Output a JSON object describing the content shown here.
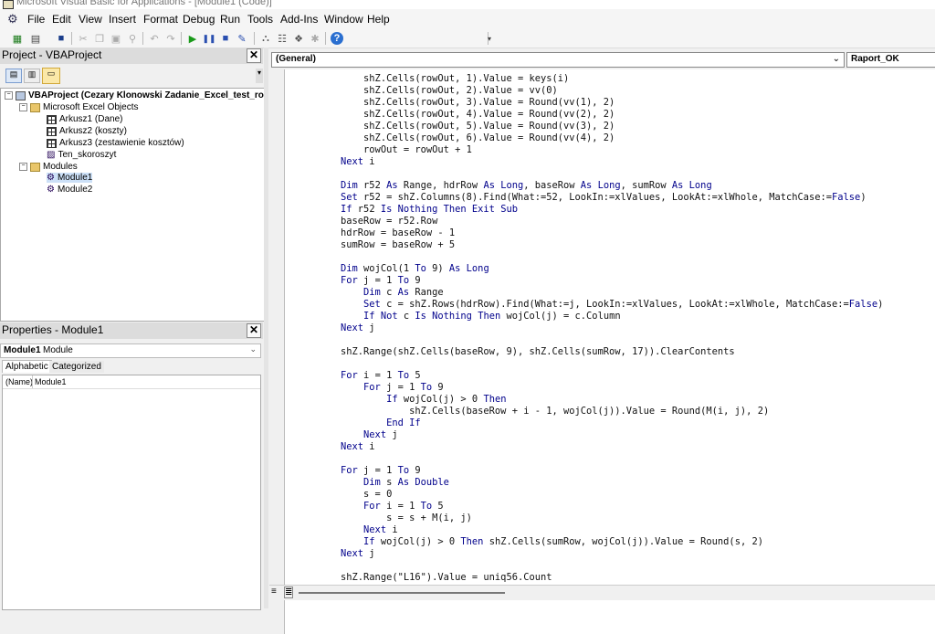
{
  "window": {
    "title": "Microsoft Visual Basic for Applications - [Module1 (Code)]"
  },
  "menu": [
    "File",
    "Edit",
    "View",
    "Insert",
    "Format",
    "Debug",
    "Run",
    "Tools",
    "Add-Ins",
    "Window",
    "Help"
  ],
  "project_panel": {
    "title": "Project - VBAProject",
    "root": "VBAProject (Cezary Klonowski Zadanie_Excel_test_roz",
    "excel_objects_folder": "Microsoft Excel Objects",
    "sheets": [
      "Arkusz1 (Dane)",
      "Arkusz2 (koszty)",
      "Arkusz3 (zestawienie kosztów)",
      "Ten_skoroszyt"
    ],
    "modules_folder": "Modules",
    "modules": [
      "Module1",
      "Module2"
    ]
  },
  "properties_panel": {
    "title": "Properties - Module1",
    "object_name": "Module1",
    "object_type": "Module",
    "tabs": [
      "Alphabetic",
      "Categorized"
    ],
    "row_key": "(Name)",
    "row_value": "Module1"
  },
  "code_window": {
    "object_combo": "(General)",
    "proc_combo": "Raport_OK",
    "lines": [
      [
        [
          "t",
          "        shZ.Cells(rowOut, 1).Value = keys(i)"
        ]
      ],
      [
        [
          "t",
          "        shZ.Cells(rowOut, 2).Value = vv(0)"
        ]
      ],
      [
        [
          "t",
          "        shZ.Cells(rowOut, 3).Value = Round(vv(1), 2)"
        ]
      ],
      [
        [
          "t",
          "        shZ.Cells(rowOut, 4).Value = Round(vv(2), 2)"
        ]
      ],
      [
        [
          "t",
          "        shZ.Cells(rowOut, 5).Value = Round(vv(3), 2)"
        ]
      ],
      [
        [
          "t",
          "        shZ.Cells(rowOut, 6).Value = Round(vv(4), 2)"
        ]
      ],
      [
        [
          "t",
          "        rowOut = rowOut + 1"
        ]
      ],
      [
        [
          "k",
          "    Next"
        ],
        [
          "t",
          " i"
        ]
      ],
      [
        [
          "t",
          ""
        ]
      ],
      [
        [
          "k",
          "    Dim"
        ],
        [
          "t",
          " r52 "
        ],
        [
          "k",
          "As"
        ],
        [
          "t",
          " Range, hdrRow "
        ],
        [
          "k",
          "As Long"
        ],
        [
          "t",
          ", baseRow "
        ],
        [
          "k",
          "As Long"
        ],
        [
          "t",
          ", sumRow "
        ],
        [
          "k",
          "As Long"
        ]
      ],
      [
        [
          "k",
          "    Set"
        ],
        [
          "t",
          " r52 = shZ.Columns(8).Find(What:=52, LookIn:=xlValues, LookAt:=xlWhole, MatchCase:="
        ],
        [
          "k",
          "False"
        ],
        [
          "t",
          ")"
        ]
      ],
      [
        [
          "k",
          "    If"
        ],
        [
          "t",
          " r52 "
        ],
        [
          "k",
          "Is Nothing Then Exit Sub"
        ]
      ],
      [
        [
          "t",
          "    baseRow = r52.Row"
        ]
      ],
      [
        [
          "t",
          "    hdrRow = baseRow - 1"
        ]
      ],
      [
        [
          "t",
          "    sumRow = baseRow + 5"
        ]
      ],
      [
        [
          "t",
          ""
        ]
      ],
      [
        [
          "k",
          "    Dim"
        ],
        [
          "t",
          " wojCol(1 "
        ],
        [
          "k",
          "To"
        ],
        [
          "t",
          " 9) "
        ],
        [
          "k",
          "As Long"
        ]
      ],
      [
        [
          "k",
          "    For"
        ],
        [
          "t",
          " j = 1 "
        ],
        [
          "k",
          "To"
        ],
        [
          "t",
          " 9"
        ]
      ],
      [
        [
          "k",
          "        Dim"
        ],
        [
          "t",
          " c "
        ],
        [
          "k",
          "As"
        ],
        [
          "t",
          " Range"
        ]
      ],
      [
        [
          "k",
          "        Set"
        ],
        [
          "t",
          " c = shZ.Rows(hdrRow).Find(What:=j, LookIn:=xlValues, LookAt:=xlWhole, MatchCase:="
        ],
        [
          "k",
          "False"
        ],
        [
          "t",
          ")"
        ]
      ],
      [
        [
          "k",
          "        If Not"
        ],
        [
          "t",
          " c "
        ],
        [
          "k",
          "Is Nothing Then"
        ],
        [
          "t",
          " wojCol(j) = c.Column"
        ]
      ],
      [
        [
          "k",
          "    Next"
        ],
        [
          "t",
          " j"
        ]
      ],
      [
        [
          "t",
          ""
        ]
      ],
      [
        [
          "t",
          "    shZ.Range(shZ.Cells(baseRow, 9), shZ.Cells(sumRow, 17)).ClearContents"
        ]
      ],
      [
        [
          "t",
          ""
        ]
      ],
      [
        [
          "k",
          "    For"
        ],
        [
          "t",
          " i = 1 "
        ],
        [
          "k",
          "To"
        ],
        [
          "t",
          " 5"
        ]
      ],
      [
        [
          "k",
          "        For"
        ],
        [
          "t",
          " j = 1 "
        ],
        [
          "k",
          "To"
        ],
        [
          "t",
          " 9"
        ]
      ],
      [
        [
          "k",
          "            If"
        ],
        [
          "t",
          " wojCol(j) > 0 "
        ],
        [
          "k",
          "Then"
        ]
      ],
      [
        [
          "t",
          "                shZ.Cells(baseRow + i - 1, wojCol(j)).Value = Round(M(i, j), 2)"
        ]
      ],
      [
        [
          "k",
          "            End If"
        ]
      ],
      [
        [
          "k",
          "        Next"
        ],
        [
          "t",
          " j"
        ]
      ],
      [
        [
          "k",
          "    Next"
        ],
        [
          "t",
          " i"
        ]
      ],
      [
        [
          "t",
          ""
        ]
      ],
      [
        [
          "k",
          "    For"
        ],
        [
          "t",
          " j = 1 "
        ],
        [
          "k",
          "To"
        ],
        [
          "t",
          " 9"
        ]
      ],
      [
        [
          "k",
          "        Dim"
        ],
        [
          "t",
          " s "
        ],
        [
          "k",
          "As Double"
        ]
      ],
      [
        [
          "t",
          "        s = 0"
        ]
      ],
      [
        [
          "k",
          "        For"
        ],
        [
          "t",
          " i = 1 "
        ],
        [
          "k",
          "To"
        ],
        [
          "t",
          " 5"
        ]
      ],
      [
        [
          "t",
          "            s = s + M(i, j)"
        ]
      ],
      [
        [
          "k",
          "        Next"
        ],
        [
          "t",
          " i"
        ]
      ],
      [
        [
          "k",
          "        If"
        ],
        [
          "t",
          " wojCol(j) > 0 "
        ],
        [
          "k",
          "Then"
        ],
        [
          "t",
          " shZ.Cells(sumRow, wojCol(j)).Value = Round(s, 2)"
        ]
      ],
      [
        [
          "k",
          "    Next"
        ],
        [
          "t",
          " j"
        ]
      ],
      [
        [
          "t",
          ""
        ]
      ],
      [
        [
          "t",
          "    shZ.Range(\"L16\").Value = uniq56.Count"
        ]
      ]
    ]
  }
}
